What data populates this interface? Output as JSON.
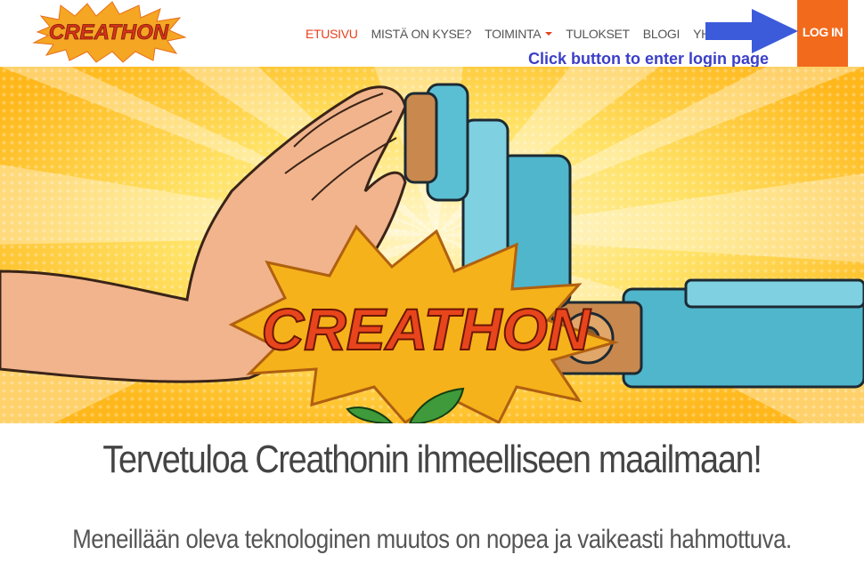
{
  "logo": {
    "text": "CREATHON"
  },
  "nav": {
    "items": [
      {
        "label": "ETUSIVU",
        "active": true
      },
      {
        "label": "MISTÄ ON KYSE?"
      },
      {
        "label": "TOIMINTA",
        "dropdown": true
      },
      {
        "label": "TULOKSET"
      },
      {
        "label": "BLOGI"
      },
      {
        "label": "YHTEYSTIED"
      }
    ],
    "login_label": "LOG IN"
  },
  "annotation": {
    "text": "Click button to enter login page",
    "color": "#3b3fc8"
  },
  "hero": {
    "badge_text": "CREATHON"
  },
  "welcome": {
    "title": "Tervetuloa Creathonin ihmeelliseen maailmaan!",
    "lead": "Meneillään oleva teknologinen muutos on nopea ja vaikeasti hahmottuva."
  },
  "colors": {
    "accent": "#e8401c",
    "login": "#f26b1d",
    "hero_bg": "#ffd33a",
    "annotation": "#3b3fc8"
  }
}
